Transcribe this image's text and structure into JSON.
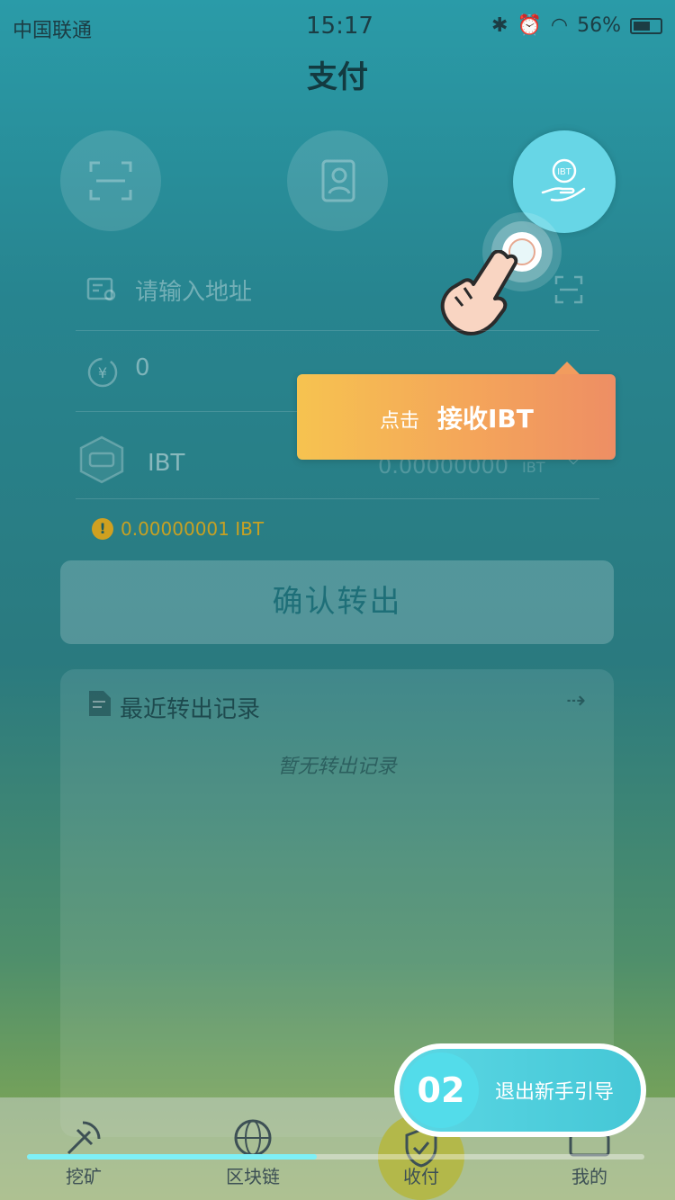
{
  "status": {
    "carrier": "中国联通",
    "time": "15:17",
    "battery": "56%"
  },
  "header": {
    "title": "支付"
  },
  "form": {
    "address_placeholder": "请输入地址",
    "amount_value": "0",
    "token_name": "IBT",
    "token_balance": "0.00000000",
    "token_unit": "IBT",
    "fee_text": "0.00000001 IBT"
  },
  "confirm_label": "确认转出",
  "records": {
    "title": "最近转出记录",
    "empty": "暂无转出记录"
  },
  "tooltip": {
    "prefix": "点击",
    "action": "接收IBT"
  },
  "tabs": [
    {
      "label": "挖矿"
    },
    {
      "label": "区块链"
    },
    {
      "label": "收付"
    },
    {
      "label": "我的"
    }
  ],
  "guide": {
    "step": "02",
    "exit_label": "退出新手引导",
    "progress": 0.47
  },
  "colors": {
    "accent": "#67d6e6",
    "tooltip_start": "#f6c350",
    "tooltip_end": "#ee8e64"
  }
}
